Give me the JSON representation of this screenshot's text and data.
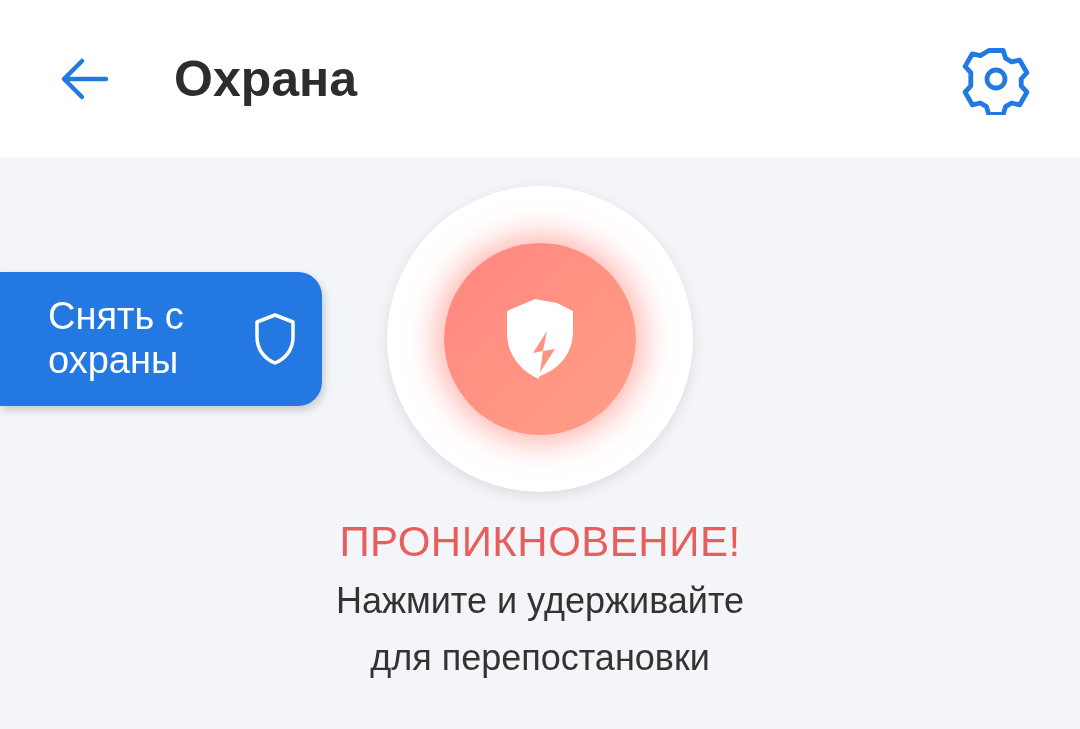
{
  "header": {
    "title": "Охрана"
  },
  "disarm_button": {
    "label": "Снять с охраны"
  },
  "alarm": {
    "triggered": true,
    "status": "ПРОНИКНОВЕНИЕ!",
    "hint_lines": [
      "Нажмите и удерживайте",
      "для перепостановки"
    ]
  }
}
